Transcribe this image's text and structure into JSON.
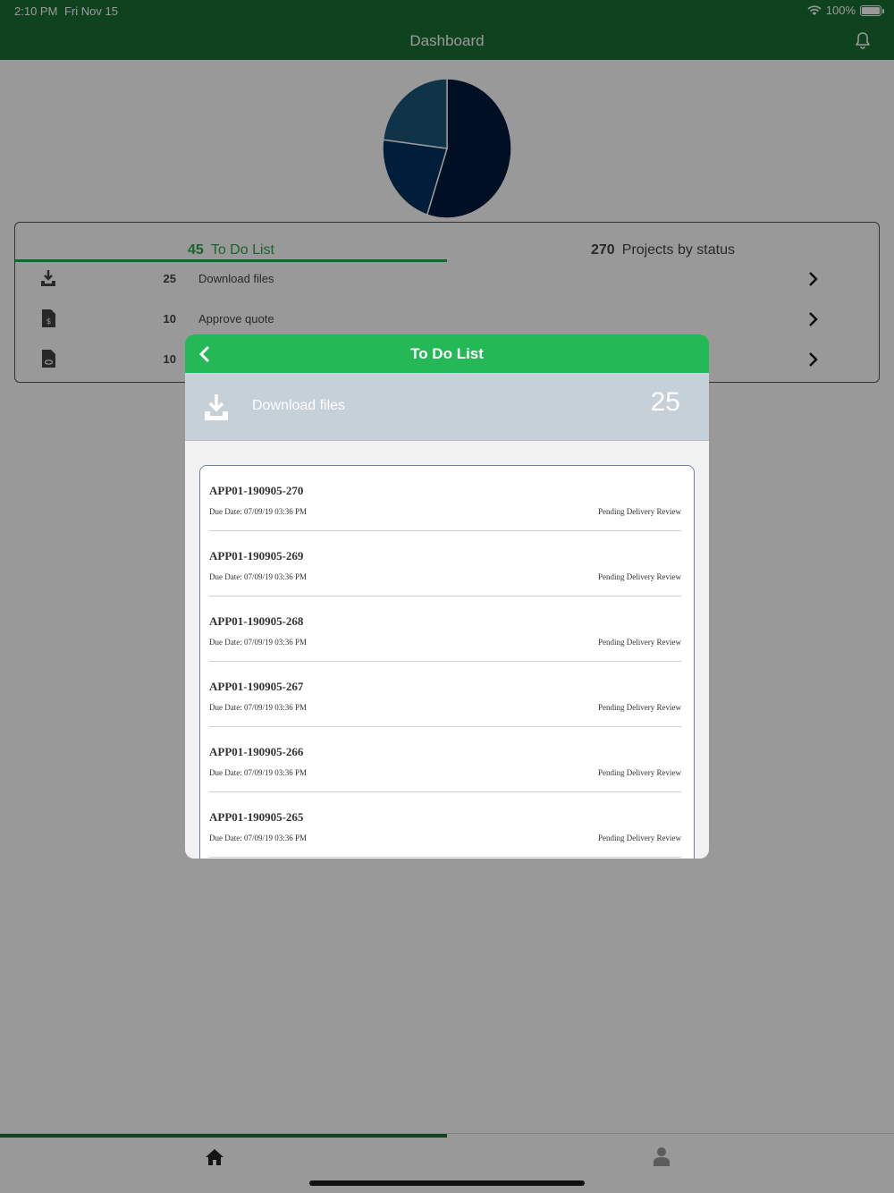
{
  "status_bar": {
    "time": "2:10 PM",
    "date": "Fri Nov 15",
    "battery": "100%"
  },
  "header": {
    "title": "Dashboard"
  },
  "chart_data": {
    "type": "pie",
    "slices": [
      {
        "value": 55,
        "color": "#011a3c"
      },
      {
        "value": 22,
        "color": "#013261"
      },
      {
        "value": 23,
        "color": "#1a567a"
      }
    ]
  },
  "summary": {
    "tabs": [
      {
        "count": "45",
        "label": "To Do List",
        "active": true
      },
      {
        "count": "270",
        "label": "Projects by status",
        "active": false
      }
    ],
    "rows": [
      {
        "icon": "download-icon",
        "count": "25",
        "label": "Download files"
      },
      {
        "icon": "invoice-icon",
        "count": "10",
        "label": "Approve quote"
      },
      {
        "icon": "file-view-icon",
        "count": "10",
        "label": ""
      }
    ]
  },
  "modal": {
    "title": "To Do List",
    "section_label": "Download files",
    "section_count": "25",
    "items": [
      {
        "id": "APP01-190905-270",
        "due": "Due Date: 07/09/19 03:36 PM",
        "status": "Pending Delivery Review"
      },
      {
        "id": "APP01-190905-269",
        "due": "Due Date: 07/09/19 03:36 PM",
        "status": "Pending Delivery Review"
      },
      {
        "id": "APP01-190905-268",
        "due": "Due Date: 07/09/19 03:36 PM",
        "status": "Pending Delivery Review"
      },
      {
        "id": "APP01-190905-267",
        "due": "Due Date: 07/09/19 03:36 PM",
        "status": "Pending Delivery Review"
      },
      {
        "id": "APP01-190905-266",
        "due": "Due Date: 07/09/19 03:36 PM",
        "status": "Pending Delivery Review"
      },
      {
        "id": "APP01-190905-265",
        "due": "Due Date: 07/09/19 03:36 PM",
        "status": "Pending Delivery Review"
      }
    ]
  },
  "tab_bar": {
    "items": [
      {
        "icon": "home-icon",
        "active": true
      },
      {
        "icon": "user-icon",
        "active": false
      }
    ]
  }
}
